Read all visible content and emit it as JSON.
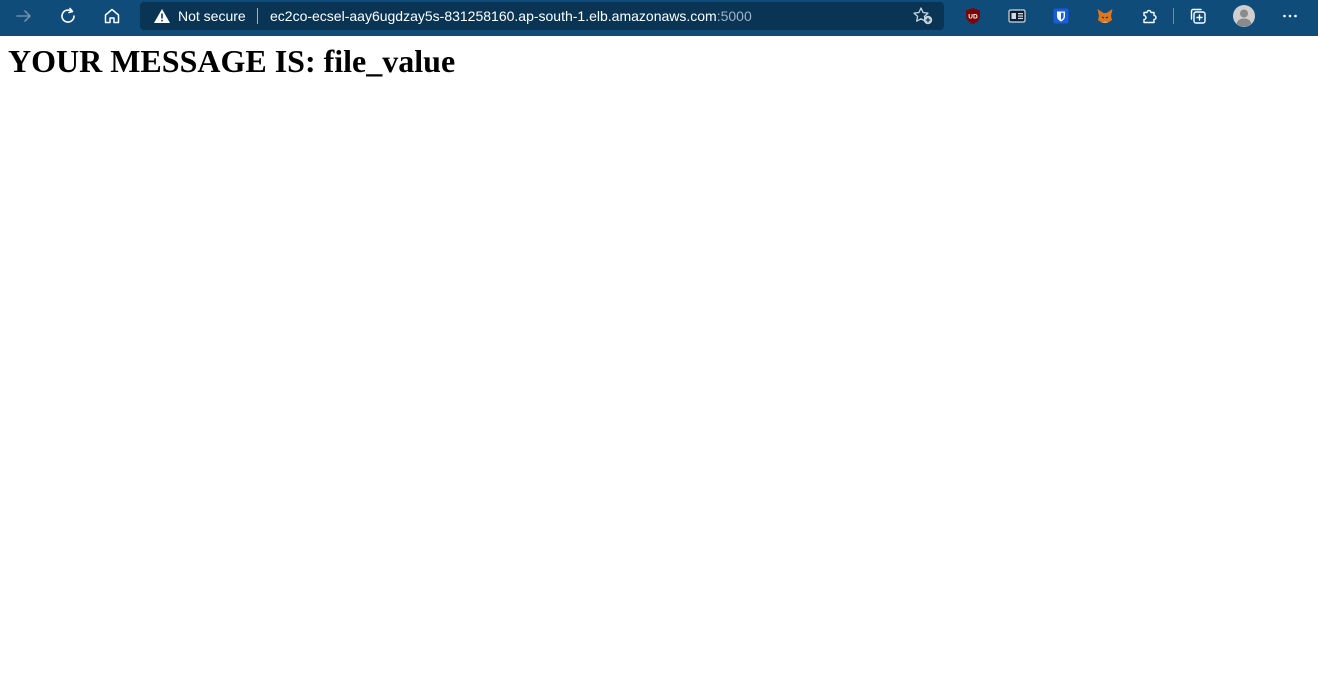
{
  "browser": {
    "security_label": "Not secure",
    "url_host": "ec2co-ecsel-aay6ugdzay5s-831258160.ap-south-1.elb.amazonaws.com",
    "url_port": ":5000",
    "colors": {
      "toolbar": "#0f4c7a",
      "addressbar": "#0a3454",
      "port_text": "#9fb3c6"
    },
    "toolbar_icons": [
      "forward-icon",
      "refresh-icon",
      "home-icon"
    ],
    "extension_icons": [
      "ublock-icon",
      "reader-icon",
      "bitwarden-icon",
      "metamask-icon",
      "extensions-icon",
      "collections-icon",
      "profile-icon",
      "more-icon"
    ],
    "ublock_badge": "UD"
  },
  "page": {
    "heading": "YOUR MESSAGE IS: file_value"
  }
}
